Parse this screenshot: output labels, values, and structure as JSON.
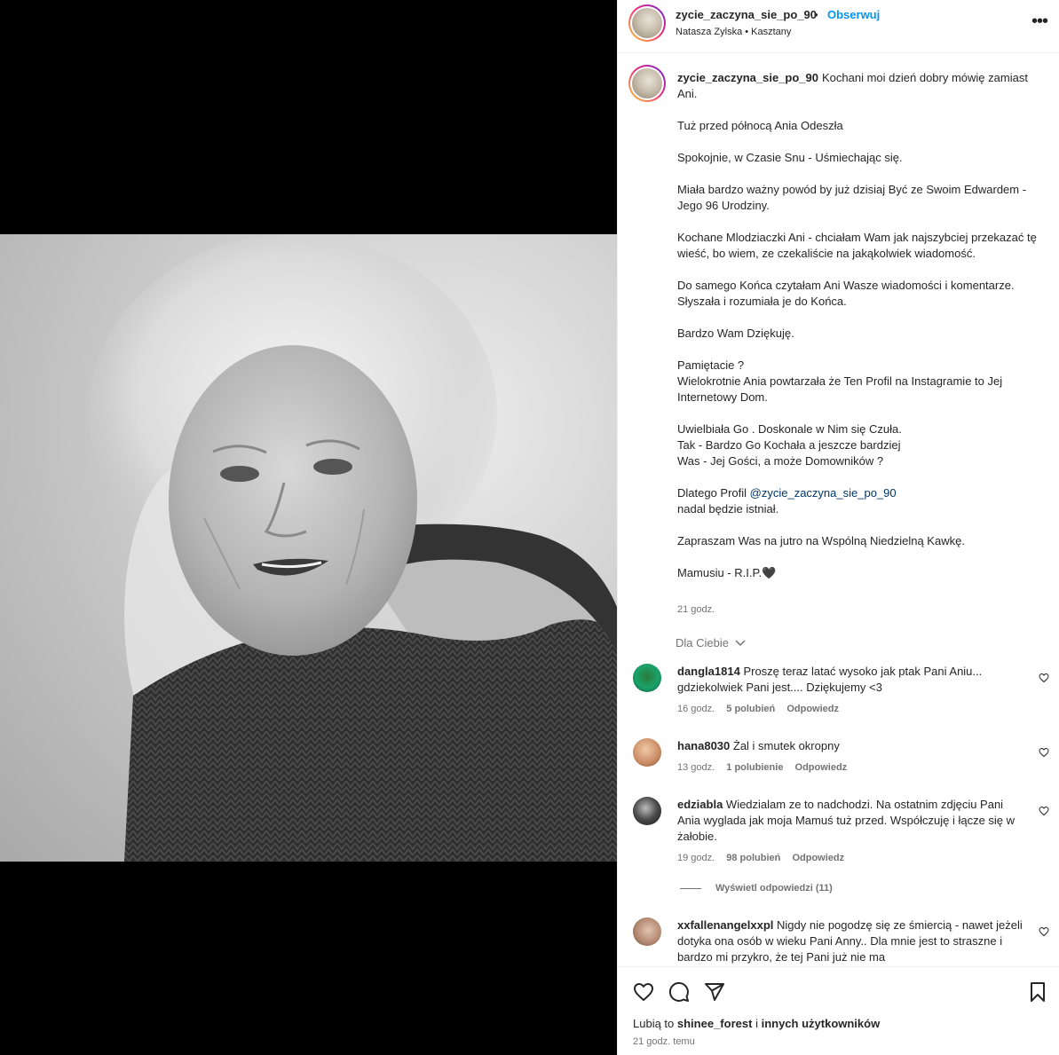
{
  "post": {
    "username": "zycie_zaczyna_sie_po_90",
    "follow_label": "Obserwuj",
    "separator": "•",
    "location": "Natasza Zylska • Kasztany",
    "more_icon": "more-horizontal-icon"
  },
  "caption": {
    "username": "zycie_zaczyna_sie_po_90",
    "text_part1": "Kochani moi dzień dobry mówię zamiast Ani.\n\nTuż przed północą Ania Odeszła\n\nSpokojnie, w Czasie Snu - Uśmiechając się.\n\nMiała bardzo ważny powód by już dzisiaj Być ze Swoim Edwardem - Jego 96 Urodziny.\n\nKochane Mlodziaczki Ani - chciałam Wam jak najszybciej przekazać tę wieść, bo wiem, ze czekaliście na jakąkolwiek wiadomość.\n\nDo samego Końca czytałam Ani Wasze wiadomości i komentarze. Słyszała i rozumiała je do Końca.\n\nBardzo Wam Dziękuję.\n\nPamiętacie ?\nWielokrotnie Ania powtarzała że Ten Profil na Instagramie to Jej Internetowy Dom.\n\nUwielbiała Go . Doskonale w Nim się Czuła.\nTak - Bardzo Go Kochała a jeszcze bardziej\nWas - Jej Gości, a może Domowników ?\n\nDlatego Profil ",
    "mention": "@zycie_zaczyna_sie_po_90",
    "text_part2": "\nnadal będzie istniał.\n\nZapraszam Was na jutro na Wspólną Niedzielną Kawkę.\n\nMamusiu - R.I.P.🖤",
    "time": "21 godz."
  },
  "for_you_label": "Dla Ciebie",
  "comments": [
    {
      "username": "dangla1814",
      "text": "Proszę teraz latać wysoko jak ptak Pani Aniu... gdziekolwiek Pani jest.... Dziękujemy <3",
      "time": "16 godz.",
      "likes": "5 polubień",
      "reply": "Odpowiedz"
    },
    {
      "username": "hana8030",
      "text": "Żal i smutek okropny",
      "time": "13 godz.",
      "likes": "1 polubienie",
      "reply": "Odpowiedz"
    },
    {
      "username": "edziabla",
      "text": "Wiedzialam ze to nadchodzi. Na ostatnim zdjęciu Pani Ania wyglada jak moja Mamuś tuż przed. Współczuję i łącze się w żałobie.",
      "time": "19 godz.",
      "likes": "98 polubień",
      "reply": "Odpowiedz"
    },
    {
      "username": "xxfallenangelxxpl",
      "text": "Nigdy nie pogodzę się ze śmiercią - nawet jeżeli dotyka ona osób w wieku Pani Anny.. Dla mnie jest to straszne i bardzo mi przykro, że tej Pani już nie ma"
    }
  ],
  "view_replies": "Wyświetl odpowiedzi (11)",
  "footer": {
    "likes_prefix": "Lubią to",
    "likes_user": "shinee_forest",
    "likes_mid": "i",
    "likes_rest": "innych użytkowników",
    "posted_time": "21 godz. temu"
  },
  "colors": {
    "accent": "#0095f6",
    "mention": "#00376b",
    "meta": "#737373",
    "text": "#262626"
  }
}
